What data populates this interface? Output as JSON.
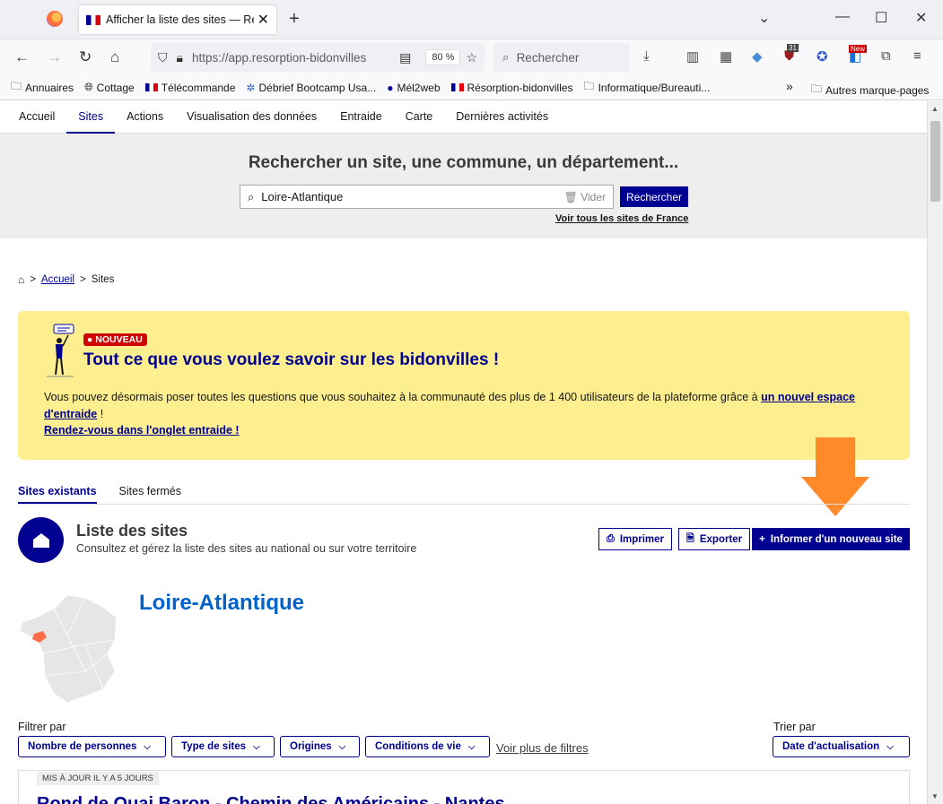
{
  "browser": {
    "tab_title": "Afficher la liste des sites — Résorption-bidonvilles",
    "url": "https://app.resorption-bidonvilles",
    "zoom": "80 %",
    "search_placeholder": "Rechercher",
    "ext_badge_count": "31",
    "ext_badge_new": "New",
    "bookmarks": [
      "Annuaires",
      "Cottage",
      "Télécommande",
      "Débrief Bootcamp Usa...",
      "Mél2web",
      "Résorption-bidonvilles",
      "Informatique/Bureauti..."
    ],
    "other_bookmarks": "Autres marque-pages"
  },
  "site_nav": {
    "items": [
      "Accueil",
      "Sites",
      "Actions",
      "Visualisation des données",
      "Entraide",
      "Carte",
      "Dernières activités"
    ],
    "active": "Sites"
  },
  "search": {
    "title": "Rechercher un site, une commune, un département...",
    "value": "Loire-Atlantique",
    "clear_label": "Vider",
    "button_label": "Rechercher",
    "see_all": "Voir tous les sites de France"
  },
  "breadcrumb": {
    "home": "Accueil",
    "current": "Sites"
  },
  "notice": {
    "badge": "NOUVEAU",
    "title": "Tout ce que vous voulez savoir sur les bidonvilles !",
    "body": "Vous pouvez désormais poser toutes les questions que vous souhaitez à la communauté des plus de 1 400 utilisateurs de la plateforme grâce à",
    "link1": "un nouvel espace d'entraide",
    "after_link1": " !",
    "link2": "Rendez-vous dans l'onglet entraide !"
  },
  "site_tabs": {
    "existing": "Sites existants",
    "closed": "Sites fermés"
  },
  "list": {
    "title": "Liste des sites",
    "subtitle": "Consultez et gérez la liste des sites au national ou sur votre territoire",
    "print": "Imprimer",
    "export": "Exporter",
    "new_site": "Informer d'un nouveau site"
  },
  "territory": {
    "name": "Loire-Atlantique"
  },
  "filters": {
    "filter_label": "Filtrer par",
    "sort_label": "Trier par",
    "buttons": [
      "Nombre de personnes",
      "Type de sites",
      "Origines",
      "Conditions de vie"
    ],
    "more": "Voir plus de filtres",
    "sort_value": "Date d'actualisation"
  },
  "card": {
    "tag": "MIS À JOUR IL Y A 5 JOURS",
    "title": "Rond de Quai Baron - Chemin des Américains - Nantes"
  },
  "colors": {
    "brand_blue": "#000091",
    "notice_bg": "#fdef8f",
    "badge_red": "#ce0500",
    "arrow_orange": "#ff8a2a",
    "region_highlight": "#ff6c47"
  }
}
